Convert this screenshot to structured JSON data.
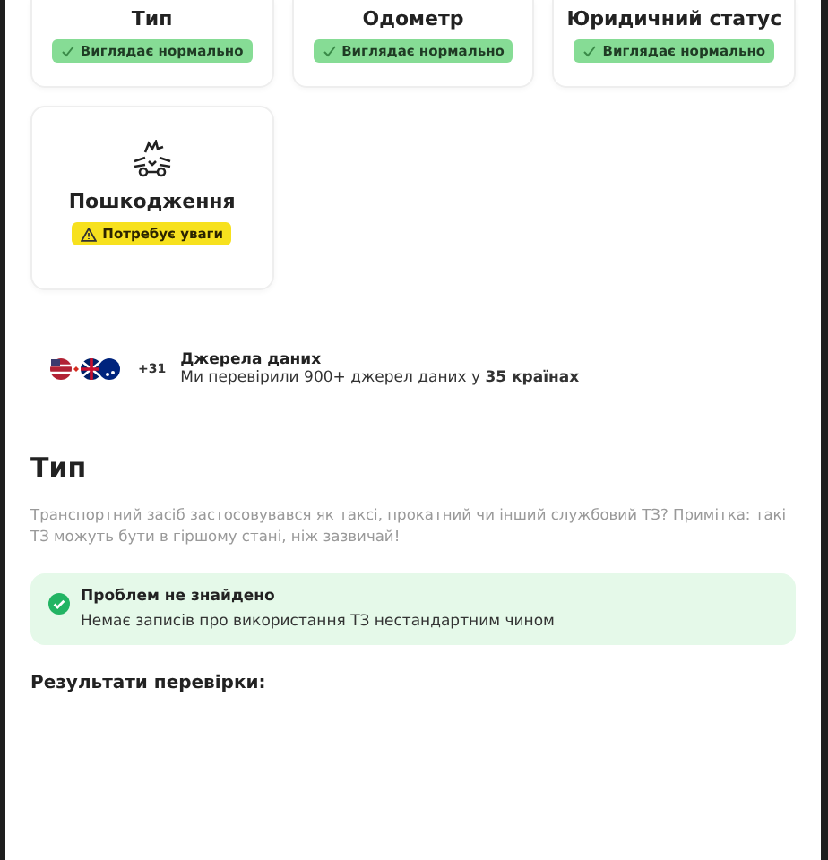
{
  "checks": [
    {
      "title": "Тип",
      "kind": "ok",
      "badge": "Виглядає нормально",
      "icon_visible": false
    },
    {
      "title": "Одометр",
      "kind": "ok",
      "badge": "Виглядає нормально",
      "icon_visible": false
    },
    {
      "title": "Юридичний статус",
      "kind": "ok",
      "badge": "Виглядає нормально",
      "icon_visible": false
    },
    {
      "title": "Пошкодження",
      "kind": "warning",
      "badge": "Потребує уваги",
      "icon_visible": true
    }
  ],
  "sources": {
    "more": "+31",
    "title": "Джерела даних",
    "text": "Ми перевірили 900+ джерел даних у **35 країнах**"
  },
  "section": {
    "title": "Тип",
    "description": "Транспортний засіб застосовувався як таксі, прокатний чи інший службовий ТЗ? Примітка: такі ТЗ можуть бути в гіршому стані, ніж зазвичай!"
  },
  "result": {
    "kind": "ok",
    "title": "Проблем не знайдено",
    "text": "Немає записів про використання ТЗ нестандартним чином"
  },
  "results_heading": "Результати перевірки:"
}
